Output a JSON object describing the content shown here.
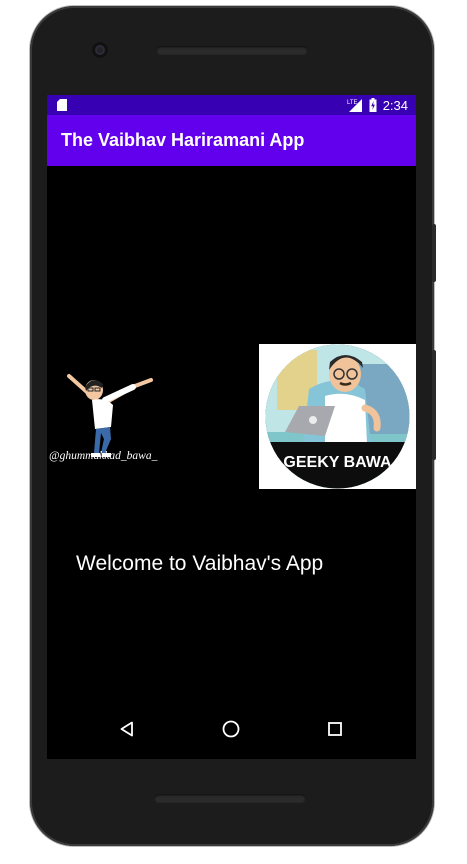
{
  "status_bar": {
    "time": "2:34",
    "network_label": "LTE"
  },
  "app_bar": {
    "title": "The Vaibhav Hariramani App"
  },
  "images": {
    "left_caption": "@ghummakkad_bawa_",
    "right_caption": "GEEKY BAWA"
  },
  "content": {
    "welcome_text": "Welcome to Vaibhav's App"
  },
  "colors": {
    "status_bar": "#3700b3",
    "app_bar": "#6200ee",
    "screen_background": "#000000"
  }
}
